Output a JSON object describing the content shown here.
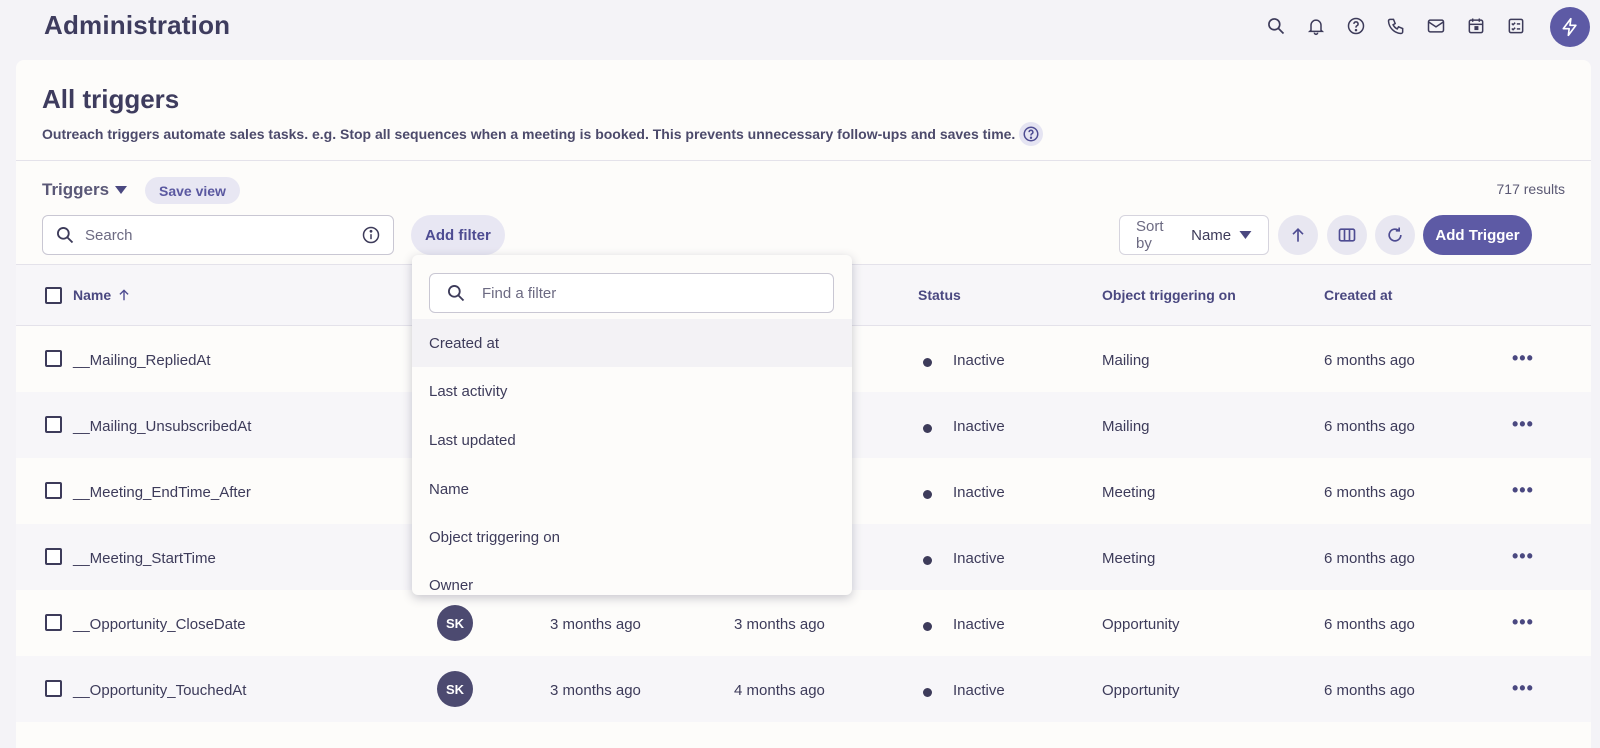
{
  "app": {
    "title": "Administration"
  },
  "top_icons": [
    "search-icon",
    "bell-icon",
    "help-icon",
    "phone-icon",
    "mail-icon",
    "calendar-icon",
    "tasks-icon"
  ],
  "page": {
    "title": "All triggers",
    "description": "Outreach triggers automate sales tasks. e.g. Stop all sequences when a meeting is booked. This prevents unnecessary follow-ups and saves time."
  },
  "toolbar": {
    "view_name": "Triggers",
    "save_view": "Save view",
    "results": "717 results",
    "search_placeholder": "Search",
    "add_filter": "Add filter",
    "sort_label": "Sort by",
    "sort_value": "Name",
    "add_trigger": "Add Trigger"
  },
  "table": {
    "columns": {
      "name": "Name",
      "status": "Status",
      "object": "Object triggering on",
      "created": "Created at"
    },
    "rows": [
      {
        "name": "__Mailing_RepliedAt",
        "status": "Inactive",
        "object": "Mailing",
        "created": "6 months ago"
      },
      {
        "name": "__Mailing_UnsubscribedAt",
        "status": "Inactive",
        "object": "Mailing",
        "created": "6 months ago"
      },
      {
        "name": "__Meeting_EndTime_After",
        "status": "Inactive",
        "object": "Meeting",
        "created": "6 months ago"
      },
      {
        "name": "__Meeting_StartTime",
        "status": "Inactive",
        "object": "Meeting",
        "created": "6 months ago"
      },
      {
        "name": "__Opportunity_CloseDate",
        "owner": "SK",
        "last_activity": "3 months ago",
        "last_updated": "3 months ago",
        "status": "Inactive",
        "object": "Opportunity",
        "created": "6 months ago"
      },
      {
        "name": "__Opportunity_TouchedAt",
        "owner": "SK",
        "last_activity": "3 months ago",
        "last_updated": "4 months ago",
        "status": "Inactive",
        "object": "Opportunity",
        "created": "6 months ago"
      }
    ]
  },
  "filter_dropdown": {
    "placeholder": "Find a filter",
    "items": [
      "Created at",
      "Last activity",
      "Last updated",
      "Name",
      "Object triggering on",
      "Owner"
    ]
  },
  "colors": {
    "accent": "#5d5aa5",
    "text": "#3d3b5a",
    "pill_bg": "#e8e7f3"
  }
}
